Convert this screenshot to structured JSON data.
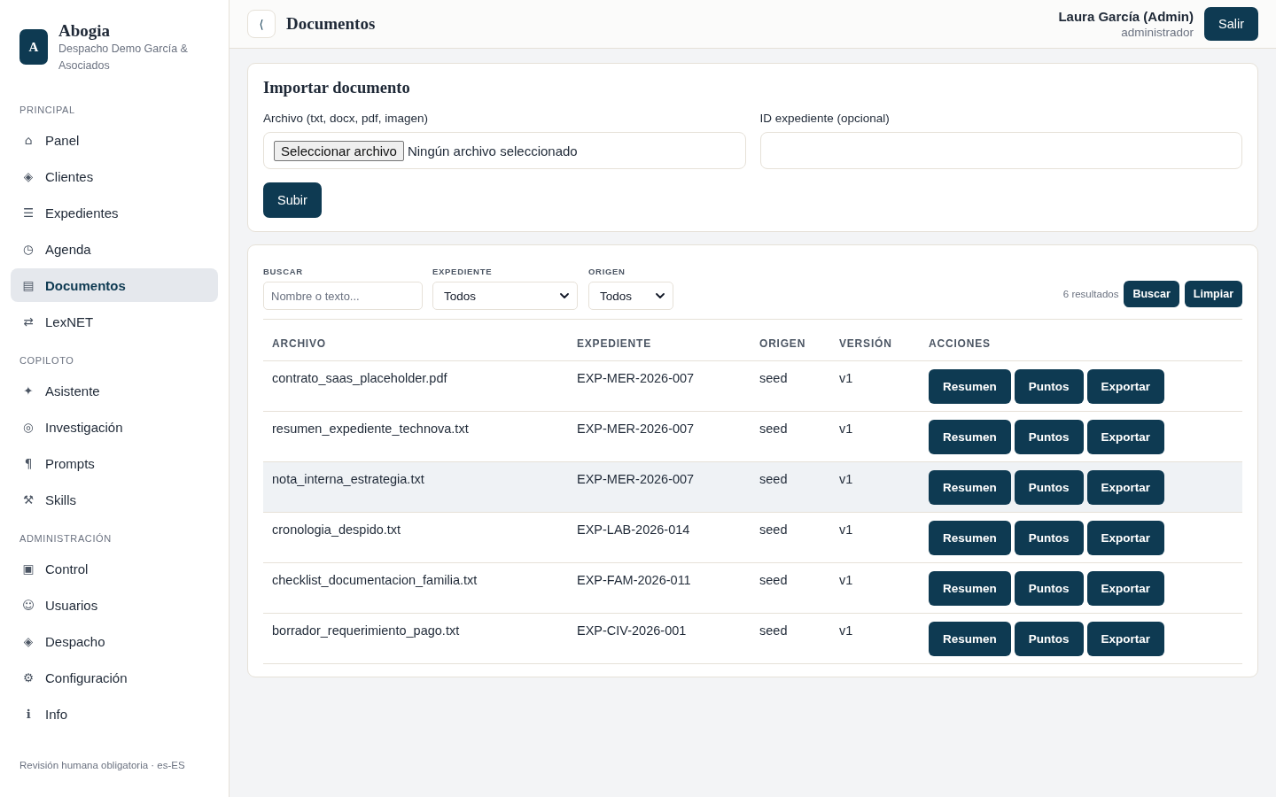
{
  "sidebar": {
    "logo": {
      "letter": "A",
      "title": "Abogia",
      "subtitle": "Despacho Demo García & Asociados"
    },
    "sections": [
      {
        "heading": "PRINCIPAL",
        "items": [
          {
            "icon": "⌂",
            "label": "Panel",
            "selected": false
          },
          {
            "icon": "◈",
            "label": "Clientes",
            "selected": false
          },
          {
            "icon": "☰",
            "label": "Expedientes",
            "selected": false
          },
          {
            "icon": "◷",
            "label": "Agenda",
            "selected": false
          },
          {
            "icon": "▤",
            "label": "Documentos",
            "selected": true
          },
          {
            "icon": "⇄",
            "label": "LexNET",
            "selected": false
          }
        ]
      },
      {
        "heading": "COPILOTO",
        "items": [
          {
            "icon": "✦",
            "label": "Asistente",
            "selected": false
          },
          {
            "icon": "◎",
            "label": "Investigación",
            "selected": false
          },
          {
            "icon": "¶",
            "label": "Prompts",
            "selected": false
          },
          {
            "icon": "⚒",
            "label": "Skills",
            "selected": false
          }
        ]
      },
      {
        "heading": "ADMINISTRACIÓN",
        "items": [
          {
            "icon": "▣",
            "label": "Control",
            "selected": false
          },
          {
            "icon": "☺",
            "label": "Usuarios",
            "selected": false
          },
          {
            "icon": "◈",
            "label": "Despacho",
            "selected": false
          },
          {
            "icon": "⚙",
            "label": "Configuración",
            "selected": false
          },
          {
            "icon": "ℹ",
            "label": "Info",
            "selected": false
          }
        ]
      }
    ],
    "footer": "Revisión humana obligatoria · es-ES"
  },
  "header": {
    "back_button": "⟨",
    "title": "Documentos",
    "user_name": "Laura García (Admin)",
    "user_role": "administrador",
    "logout_button": "Salir"
  },
  "import_card": {
    "title": "Importar documento",
    "file_field": {
      "label": "Archivo (txt, docx, pdf, imagen)",
      "button": "Seleccionar archivo",
      "status": "Ningún archivo seleccionado"
    },
    "case_field": {
      "label": "ID expediente (opcional)"
    },
    "submit_button": "Subir"
  },
  "documents_card": {
    "filters": [
      {
        "kind": "text",
        "label": "BUSCAR",
        "placeholder": "Nombre o texto..."
      },
      {
        "kind": "select",
        "label": "EXPEDIENTE",
        "value": "Todos"
      },
      {
        "kind": "select",
        "label": "ORIGEN",
        "value": "Todos"
      }
    ],
    "result_count": "6 resultados",
    "buttons": [
      "Buscar",
      "Limpiar"
    ],
    "table": {
      "columns": [
        "ARCHIVO",
        "EXPEDIENTE",
        "ORIGEN",
        "VERSIÓN",
        "ACCIONES"
      ],
      "rows": [
        {
          "cells": [
            "contrato_saas_placeholder.pdf",
            "EXP-MER-2026-007",
            "seed",
            "v1"
          ],
          "actions": [
            "Resumen",
            "Puntos",
            "Exportar"
          ],
          "highlighted": false
        },
        {
          "cells": [
            "resumen_expediente_technova.txt",
            "EXP-MER-2026-007",
            "seed",
            "v1"
          ],
          "actions": [
            "Resumen",
            "Puntos",
            "Exportar"
          ],
          "highlighted": false
        },
        {
          "cells": [
            "nota_interna_estrategia.txt",
            "EXP-MER-2026-007",
            "seed",
            "v1"
          ],
          "actions": [
            "Resumen",
            "Puntos",
            "Exportar"
          ],
          "highlighted": true
        },
        {
          "cells": [
            "cronologia_despido.txt",
            "EXP-LAB-2026-014",
            "seed",
            "v1"
          ],
          "actions": [
            "Resumen",
            "Puntos",
            "Exportar"
          ],
          "highlighted": false
        },
        {
          "cells": [
            "checklist_documentacion_familia.txt",
            "EXP-FAM-2026-011",
            "seed",
            "v1"
          ],
          "actions": [
            "Resumen",
            "Puntos",
            "Exportar"
          ],
          "highlighted": false
        },
        {
          "cells": [
            "borrador_requerimiento_pago.txt",
            "EXP-CIV-2026-001",
            "seed",
            "v1"
          ],
          "actions": [
            "Resumen",
            "Puntos",
            "Exportar"
          ],
          "highlighted": false
        }
      ]
    }
  }
}
